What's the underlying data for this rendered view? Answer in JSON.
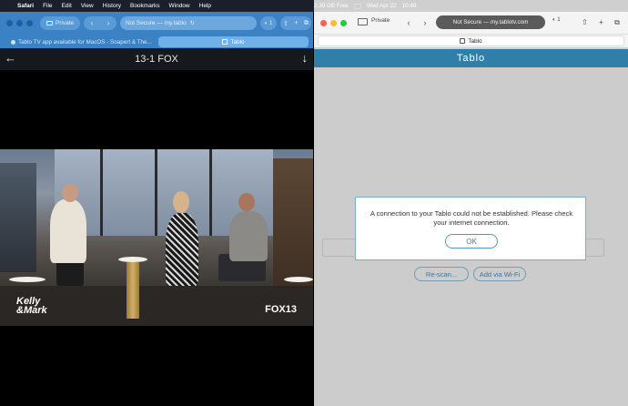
{
  "menubar": {
    "apple_glyph": "",
    "items": [
      "Safari",
      "File",
      "Edit",
      "View",
      "History",
      "Bookmarks",
      "Window",
      "Help"
    ],
    "status": {
      "disk": "2.39 GB Free",
      "date": "Wed Apr 22",
      "time": "10:49"
    }
  },
  "left_window": {
    "private_label": "Private",
    "address_text": "Not Secure — my.tablo",
    "tab1_label": "Tablo TV app available for MacOS - Soapert & The...",
    "tab2_label": "Tablo",
    "channel_title": "13-1 FOX",
    "back_glyph": "←",
    "down_glyph": "↓",
    "video_logo_left": "Kelly\n&Mark",
    "video_logo_right": "FOX13",
    "nav_back": "‹",
    "nav_forward": "›",
    "tools": [
      "⇧",
      "+",
      "⧉"
    ],
    "ext_label": "◐ 1"
  },
  "right_window": {
    "private_label": "Private",
    "address_text": "Not Secure — my.tablotv.com",
    "nav_back": "‹",
    "nav_forward": "›",
    "ext_label": "◐ 1",
    "tools": [
      "⇧",
      "+",
      "⧉"
    ],
    "tab_label": "Tablo",
    "app_title": "Tablo",
    "dialog": {
      "message": "A connection to your Tablo could not be established. Please check your internet connection.",
      "ok_label": "OK"
    },
    "rescan_label": "Re-scan...",
    "add_wifi_label": "Add via Wi-Fi"
  },
  "colors": {
    "left_toolbar": "#3b82c4",
    "tablo_blue": "#2f7fa8",
    "dialog_border": "#7aaed1"
  }
}
